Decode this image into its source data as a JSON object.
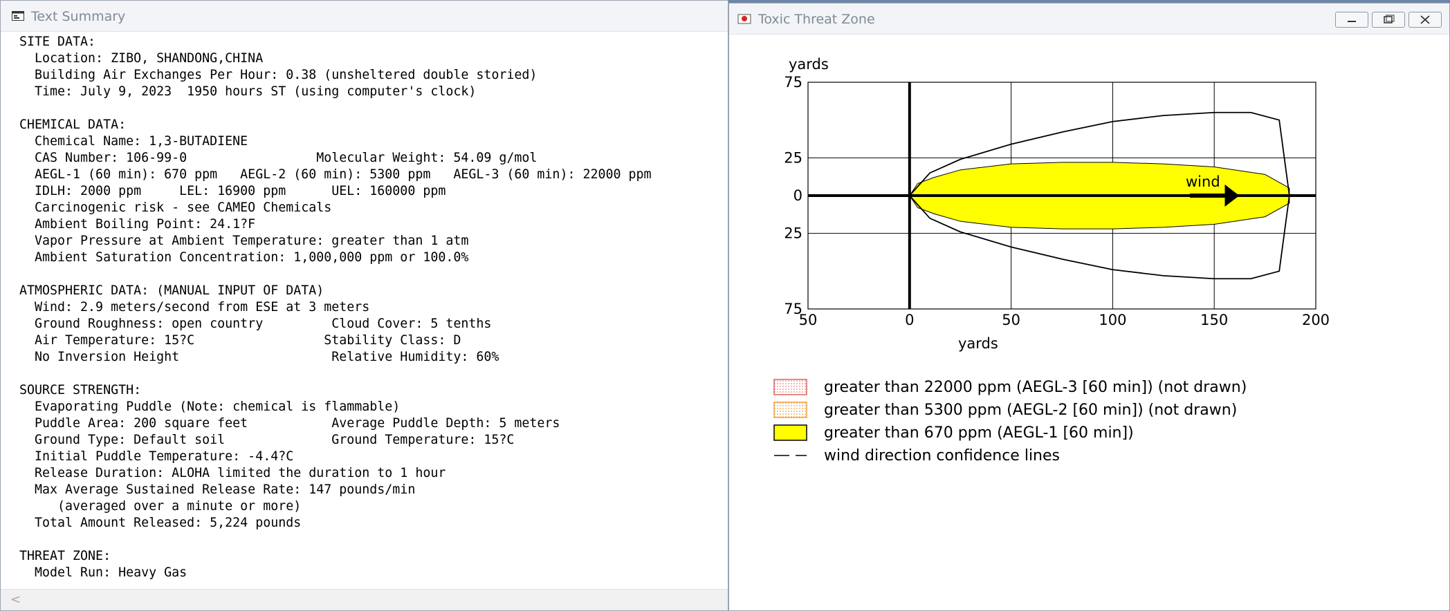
{
  "text_summary": {
    "title": "Text Summary",
    "lines": [
      "SITE DATA:",
      "  Location: ZIBO, SHANDONG,CHINA",
      "  Building Air Exchanges Per Hour: 0.38 (unsheltered double storied)",
      "  Time: July 9, 2023  1950 hours ST (using computer's clock)",
      "",
      "CHEMICAL DATA:",
      "  Chemical Name: 1,3-BUTADIENE",
      "  CAS Number: 106-99-0                 Molecular Weight: 54.09 g/mol",
      "  AEGL-1 (60 min): 670 ppm   AEGL-2 (60 min): 5300 ppm   AEGL-3 (60 min): 22000 ppm",
      "  IDLH: 2000 ppm     LEL: 16900 ppm      UEL: 160000 ppm",
      "  Carcinogenic risk - see CAMEO Chemicals",
      "  Ambient Boiling Point: 24.1?F",
      "  Vapor Pressure at Ambient Temperature: greater than 1 atm",
      "  Ambient Saturation Concentration: 1,000,000 ppm or 100.0%",
      "",
      "ATMOSPHERIC DATA: (MANUAL INPUT OF DATA)",
      "  Wind: 2.9 meters/second from ESE at 3 meters",
      "  Ground Roughness: open country         Cloud Cover: 5 tenths",
      "  Air Temperature: 15?C                 Stability Class: D",
      "  No Inversion Height                    Relative Humidity: 60%",
      "",
      "SOURCE STRENGTH:",
      "  Evaporating Puddle (Note: chemical is flammable)",
      "  Puddle Area: 200 square feet           Average Puddle Depth: 5 meters",
      "  Ground Type: Default soil              Ground Temperature: 15?C",
      "  Initial Puddle Temperature: -4.4?C",
      "  Release Duration: ALOHA limited the duration to 1 hour",
      "  Max Average Sustained Release Rate: 147 pounds/min",
      "     (averaged over a minute or more)",
      "  Total Amount Released: 5,224 pounds",
      "",
      "THREAT ZONE:",
      "  Model Run: Heavy Gas"
    ],
    "scroll_left_glyph": "<"
  },
  "threat_zone": {
    "title": "Toxic Threat Zone",
    "wind_label": "wind",
    "colors": {
      "aegl1_fill": "#ffff00",
      "aegl3_swatch": "#e06060",
      "aegl2_swatch": "#f0a040"
    },
    "legend": [
      {
        "label": "greater than 22000 ppm (AEGL-3 [60 min]) (not drawn)",
        "swatch": "red-dotted"
      },
      {
        "label": "greater than 5300 ppm (AEGL-2 [60 min]) (not drawn)",
        "swatch": "orange-dotted"
      },
      {
        "label": "greater than 670 ppm (AEGL-1 [60 min])",
        "swatch": "yellow"
      },
      {
        "label": "wind direction confidence lines",
        "swatch": "dashed-line"
      }
    ]
  },
  "chart_data": {
    "type": "area",
    "xlabel": "yards",
    "ylabel": "yards",
    "xlim": [
      -50,
      200
    ],
    "ylim": [
      -75,
      75
    ],
    "x_ticks": [
      "50",
      "0",
      "50",
      "100",
      "150",
      "200"
    ],
    "y_ticks": [
      "75",
      "25",
      "0",
      "25",
      "75"
    ],
    "grid": true,
    "legend_position": "bottom",
    "series": [
      {
        "name": "greater than 670 ppm (AEGL-1 [60 min])",
        "x": [
          0,
          4,
          12,
          25,
          50,
          75,
          100,
          125,
          150,
          175,
          187
        ],
        "y_upper": [
          0,
          8,
          12,
          17,
          21,
          22,
          22,
          21,
          19,
          14,
          5
        ],
        "y_lower": [
          0,
          -8,
          -12,
          -17,
          -21,
          -22,
          -22,
          -21,
          -19,
          -14,
          -5
        ]
      },
      {
        "name": "wind direction confidence lines",
        "x": [
          0,
          10,
          25,
          50,
          75,
          100,
          125,
          150,
          168,
          182,
          187
        ],
        "y_upper": [
          0,
          15,
          24,
          34,
          42,
          49,
          53,
          55,
          55,
          50,
          0
        ],
        "y_lower": [
          0,
          -15,
          -24,
          -34,
          -42,
          -49,
          -53,
          -55,
          -55,
          -50,
          0
        ]
      }
    ]
  }
}
